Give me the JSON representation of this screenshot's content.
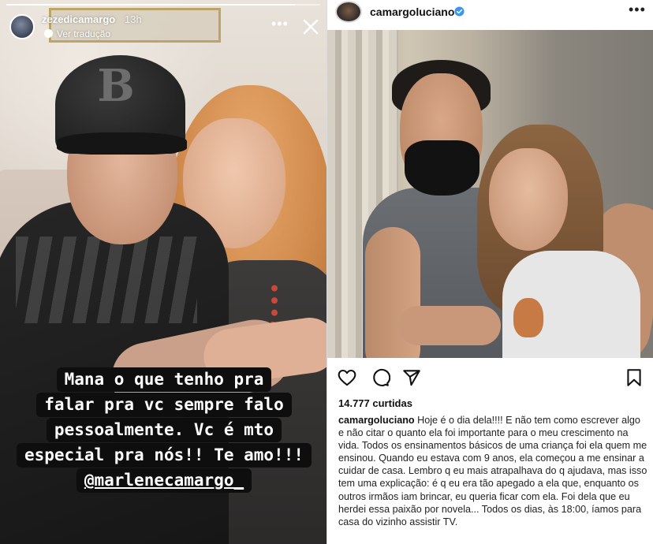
{
  "story": {
    "username": "zezedicamargo",
    "time": "13h",
    "translate_label": "Ver tradução",
    "progress": 0.92,
    "caption_lines": [
      "Mana o que tenho pra",
      "falar pra vc sempre falo",
      "pessoalmente. Vc é mto",
      "especial pra nós!! Te amo!!!"
    ],
    "mention": "@marlenecamargo_"
  },
  "post": {
    "username": "camargoluciano",
    "likes_count": "14.777",
    "likes_label": "curtidas",
    "caption_user": "camargoluciano",
    "caption_text": "Hoje é o dia dela!!!! E não tem como escrever algo e não citar o quanto ela foi importante para o meu crescimento na vida. Todos os ensinamentos básicos de uma criança foi ela quem me ensinou. Quando eu estava com 9 anos, ela começou a me ensinar a cuidar de casa. Lembro q eu mais atrapalhava do q ajudava, mas isso tem uma explicação: é q eu era tão apegado a ela que, enquanto os outros irmãos iam brincar, eu queria ficar com ela. Foi  dela que eu herdei essa paixão por novela... Todos os dias, às 18:00, íamos para casa do vizinho assistir TV."
  },
  "icons": {
    "story_more": "more-options-icon",
    "story_close": "close-icon",
    "verified": "verified-badge-icon",
    "like": "heart-icon",
    "comment": "comment-icon",
    "share": "send-icon",
    "save": "bookmark-icon"
  },
  "colors": {
    "verified_blue": "#3897f0",
    "text_dark": "#111111",
    "caption_bg": "#0e0e0e"
  }
}
